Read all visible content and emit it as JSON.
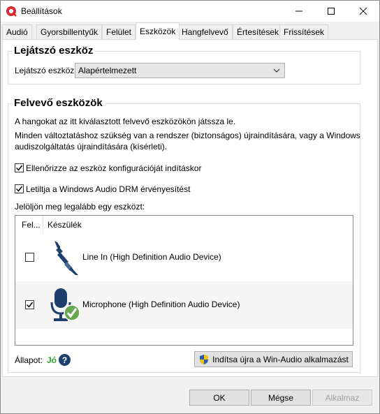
{
  "window": {
    "title": "Beállítások"
  },
  "tabs": [
    {
      "label": "Audió",
      "active": false
    },
    {
      "label": "Gyorsbillentyűk",
      "active": false
    },
    {
      "label": "Felület",
      "active": false
    },
    {
      "label": "Eszközök",
      "active": true
    },
    {
      "label": "Hangfelvevő",
      "active": false
    },
    {
      "label": "Értesítések",
      "active": false
    },
    {
      "label": "Frissítések",
      "active": false
    }
  ],
  "playback": {
    "group_title": "Lejátszó eszköz",
    "device_label": "Lejátszó eszköz:",
    "device_value": "Alapértelmezett"
  },
  "recording": {
    "group_title": "Felvevő eszközök",
    "info_line1": "A hangokat az itt kiválasztott felvevő eszközökön játssza le.",
    "info_line2": "Minden változtatáshoz szükség van a rendszer (biztonságos) újraindítására, vagy a Windows",
    "info_line3": "audiszolgáltatás újraindítására (kísérleti).",
    "check_config_label": "Ellenőrizze az eszköz konfigurációját indításkor",
    "check_config_checked": true,
    "check_drm_label": "Letiltja a Windows Audio DRM érvényesítést",
    "check_drm_checked": true,
    "select_hint": "Jelöljön meg legalább egy eszközt:",
    "columns": {
      "enabled": "Fel...",
      "device": "Készülék"
    },
    "devices": [
      {
        "name": "Line In (High Definition Audio Device)",
        "checked": false,
        "icon": "line-in-jack-icon"
      },
      {
        "name": "Microphone (High Definition Audio Device)",
        "checked": true,
        "icon": "microphone-icon"
      }
    ],
    "status_label": "Állapot:",
    "status_value": "Jó",
    "restart_button": "Indítsa újra a Win-Audio alkalmazást"
  },
  "footer": {
    "ok": "OK",
    "cancel": "Mégse",
    "apply": "Alkalmaz"
  },
  "colors": {
    "status_ok": "#2da12d",
    "accent_blue": "#1e3f6e",
    "app_red": "#d9262c"
  }
}
